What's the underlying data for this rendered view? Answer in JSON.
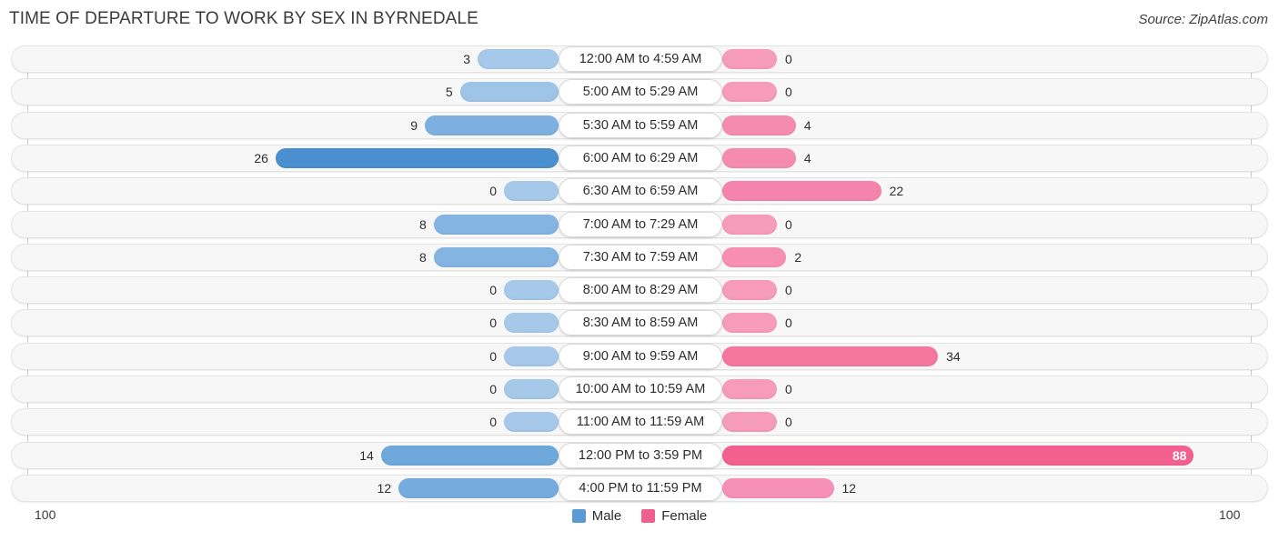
{
  "header": {
    "title": "TIME OF DEPARTURE TO WORK BY SEX IN BYRNEDALE",
    "source": "Source: ZipAtlas.com"
  },
  "legend": {
    "male_label": "Male",
    "female_label": "Female",
    "male_color": "#5b9bd5",
    "female_color": "#f0608d"
  },
  "axis": {
    "left_tick": "100",
    "right_tick": "100"
  },
  "chart_data": {
    "type": "bar",
    "title": "TIME OF DEPARTURE TO WORK BY SEX IN BYRNEDALE",
    "subtitle": "",
    "orientation": "horizontal-diverging",
    "xlabel": "",
    "ylabel": "",
    "xlim": [
      100,
      100
    ],
    "grid": false,
    "legend_position": "bottom-center",
    "categories": [
      "12:00 AM to 4:59 AM",
      "5:00 AM to 5:29 AM",
      "5:30 AM to 5:59 AM",
      "6:00 AM to 6:29 AM",
      "6:30 AM to 6:59 AM",
      "7:00 AM to 7:29 AM",
      "7:30 AM to 7:59 AM",
      "8:00 AM to 8:29 AM",
      "8:30 AM to 8:59 AM",
      "9:00 AM to 9:59 AM",
      "10:00 AM to 10:59 AM",
      "11:00 AM to 11:59 AM",
      "12:00 PM to 3:59 PM",
      "4:00 PM to 11:59 PM"
    ],
    "series": [
      {
        "name": "Male",
        "color": "#5b9bd5",
        "values": [
          3,
          5,
          9,
          26,
          0,
          8,
          8,
          0,
          0,
          0,
          0,
          0,
          14,
          12
        ]
      },
      {
        "name": "Female",
        "color": "#f0608d",
        "values": [
          0,
          0,
          4,
          4,
          22,
          0,
          2,
          0,
          0,
          34,
          0,
          0,
          88,
          12
        ]
      }
    ],
    "rows": [
      {
        "label": "12:00 AM to 4:59 AM",
        "male": 3,
        "female": 0,
        "male_text": "3",
        "female_text": "0",
        "male_color": "#a6c9ea",
        "female_color": "#f79bbb",
        "female_inside": false
      },
      {
        "label": "5:00 AM to 5:29 AM",
        "male": 5,
        "female": 0,
        "male_text": "5",
        "female_text": "0",
        "male_color": "#9ec4e8",
        "female_color": "#f79bbb",
        "female_inside": false
      },
      {
        "label": "5:30 AM to 5:59 AM",
        "male": 9,
        "female": 4,
        "male_text": "9",
        "female_text": "4",
        "male_color": "#7db0e0",
        "female_color": "#f58cb0",
        "female_inside": false
      },
      {
        "label": "6:00 AM to 6:29 AM",
        "male": 26,
        "female": 4,
        "male_text": "26",
        "female_text": "4",
        "male_color": "#4a90d0",
        "female_color": "#f58cb0",
        "female_inside": false
      },
      {
        "label": "6:30 AM to 6:59 AM",
        "male": 0,
        "female": 22,
        "male_text": "0",
        "female_text": "22",
        "male_color": "#a6c9ea",
        "female_color": "#f584ac",
        "female_inside": false
      },
      {
        "label": "7:00 AM to 7:29 AM",
        "male": 8,
        "female": 0,
        "male_text": "8",
        "female_text": "0",
        "male_color": "#84b4e2",
        "female_color": "#f79bbb",
        "female_inside": false
      },
      {
        "label": "7:30 AM to 7:59 AM",
        "male": 8,
        "female": 2,
        "male_text": "8",
        "female_text": "2",
        "male_color": "#84b4e2",
        "female_color": "#f78fb3",
        "female_inside": false
      },
      {
        "label": "8:00 AM to 8:29 AM",
        "male": 0,
        "female": 0,
        "male_text": "0",
        "female_text": "0",
        "male_color": "#a6c9ea",
        "female_color": "#f79bbb",
        "female_inside": false
      },
      {
        "label": "8:30 AM to 8:59 AM",
        "male": 0,
        "female": 0,
        "male_text": "0",
        "female_text": "0",
        "male_color": "#a6c9ea",
        "female_color": "#f79bbb",
        "female_inside": false
      },
      {
        "label": "9:00 AM to 9:59 AM",
        "male": 0,
        "female": 34,
        "male_text": "0",
        "female_text": "34",
        "male_color": "#a6c9ea",
        "female_color": "#f5779f",
        "female_inside": false
      },
      {
        "label": "10:00 AM to 10:59 AM",
        "male": 0,
        "female": 0,
        "male_text": "0",
        "female_text": "0",
        "male_color": "#a6c9ea",
        "female_color": "#f79bbb",
        "female_inside": false
      },
      {
        "label": "11:00 AM to 11:59 AM",
        "male": 0,
        "female": 0,
        "male_text": "0",
        "female_text": "0",
        "male_color": "#a6c9ea",
        "female_color": "#f79bbb",
        "female_inside": false
      },
      {
        "label": "12:00 PM to 3:59 PM",
        "male": 14,
        "female": 88,
        "male_text": "14",
        "female_text": "88",
        "male_color": "#6fa8db",
        "female_color": "#f2608f",
        "female_inside": true
      },
      {
        "label": "4:00 PM to 11:59 PM",
        "male": 12,
        "female": 12,
        "male_text": "12",
        "female_text": "12",
        "male_color": "#76abdd",
        "female_color": "#f790b6",
        "female_inside": false
      }
    ]
  }
}
